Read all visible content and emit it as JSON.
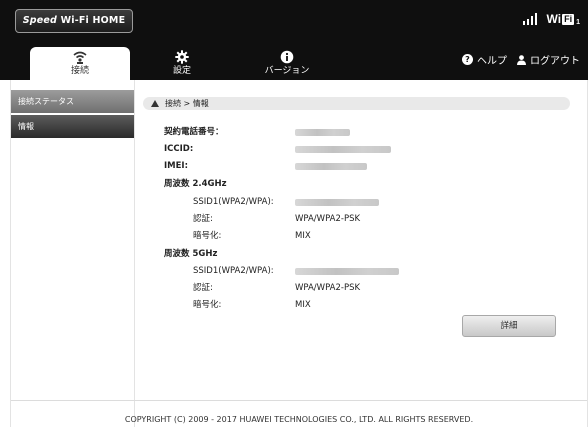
{
  "header": {
    "logo_prefix": "Speed",
    "logo_suffix": "Wi-Fi HOME",
    "status_wifi_text": "Wi",
    "status_wifi_box": "Fi",
    "status_wifi_sub": "1"
  },
  "nav": {
    "tabs": [
      {
        "label": "接続",
        "icon": "wifi-router-icon"
      },
      {
        "label": "設定",
        "icon": "gear-icon"
      },
      {
        "label": "バージョン",
        "icon": "info-icon"
      }
    ],
    "help_label": "ヘルプ",
    "logout_label": "ログアウト"
  },
  "sidebar": {
    "items": [
      {
        "label": "接続ステータス"
      },
      {
        "label": "情報"
      }
    ]
  },
  "breadcrumb": "接続 > 情報",
  "info": {
    "contract_phone_label": "契約電話番号：",
    "iccid_label": "ICCID:",
    "imei_label": "IMEI:",
    "band24_label": "周波数 2.4GHz",
    "band5_label": "周波数 5GHz",
    "ssid_label": "SSID1(WPA2/WPA):",
    "auth_label": "認証:",
    "enc_label": "暗号化:",
    "band24_auth_value": "WPA/WPA2-PSK",
    "band24_enc_value": "MIX",
    "band5_auth_value": "WPA/WPA2-PSK",
    "band5_enc_value": "MIX"
  },
  "detail_button": "詳細",
  "footer": "COPYRIGHT (C) 2009 - 2017 HUAWEI TECHNOLOGIES CO., LTD. ALL RIGHTS RESERVED."
}
